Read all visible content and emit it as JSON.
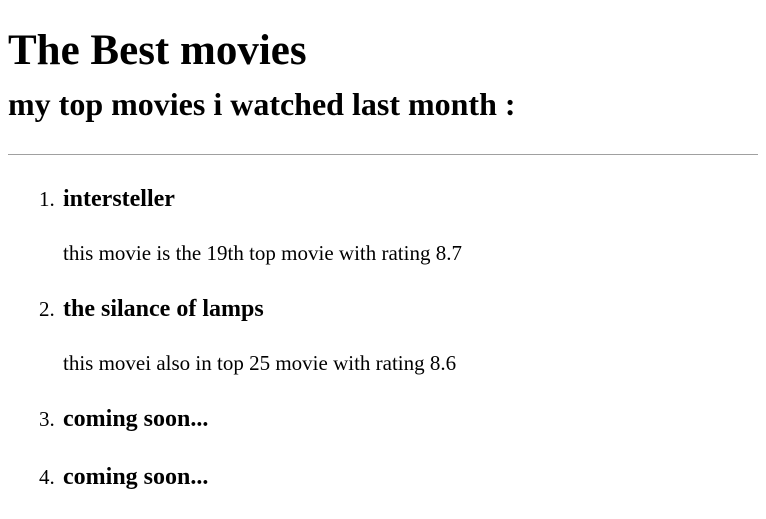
{
  "page": {
    "title": "The Best movies",
    "subtitle": "my top movies i watched last month :"
  },
  "movies": [
    {
      "number": "1.",
      "title": "intersteller",
      "description": "this movie is the 19th top movie with rating 8.7"
    },
    {
      "number": "2.",
      "title": "the silance of lamps",
      "description": "this movei also in top 25 movie with rating 8.6"
    },
    {
      "number": "3.",
      "title": "coming soon..."
    },
    {
      "number": "4.",
      "title": "coming soon..."
    }
  ]
}
